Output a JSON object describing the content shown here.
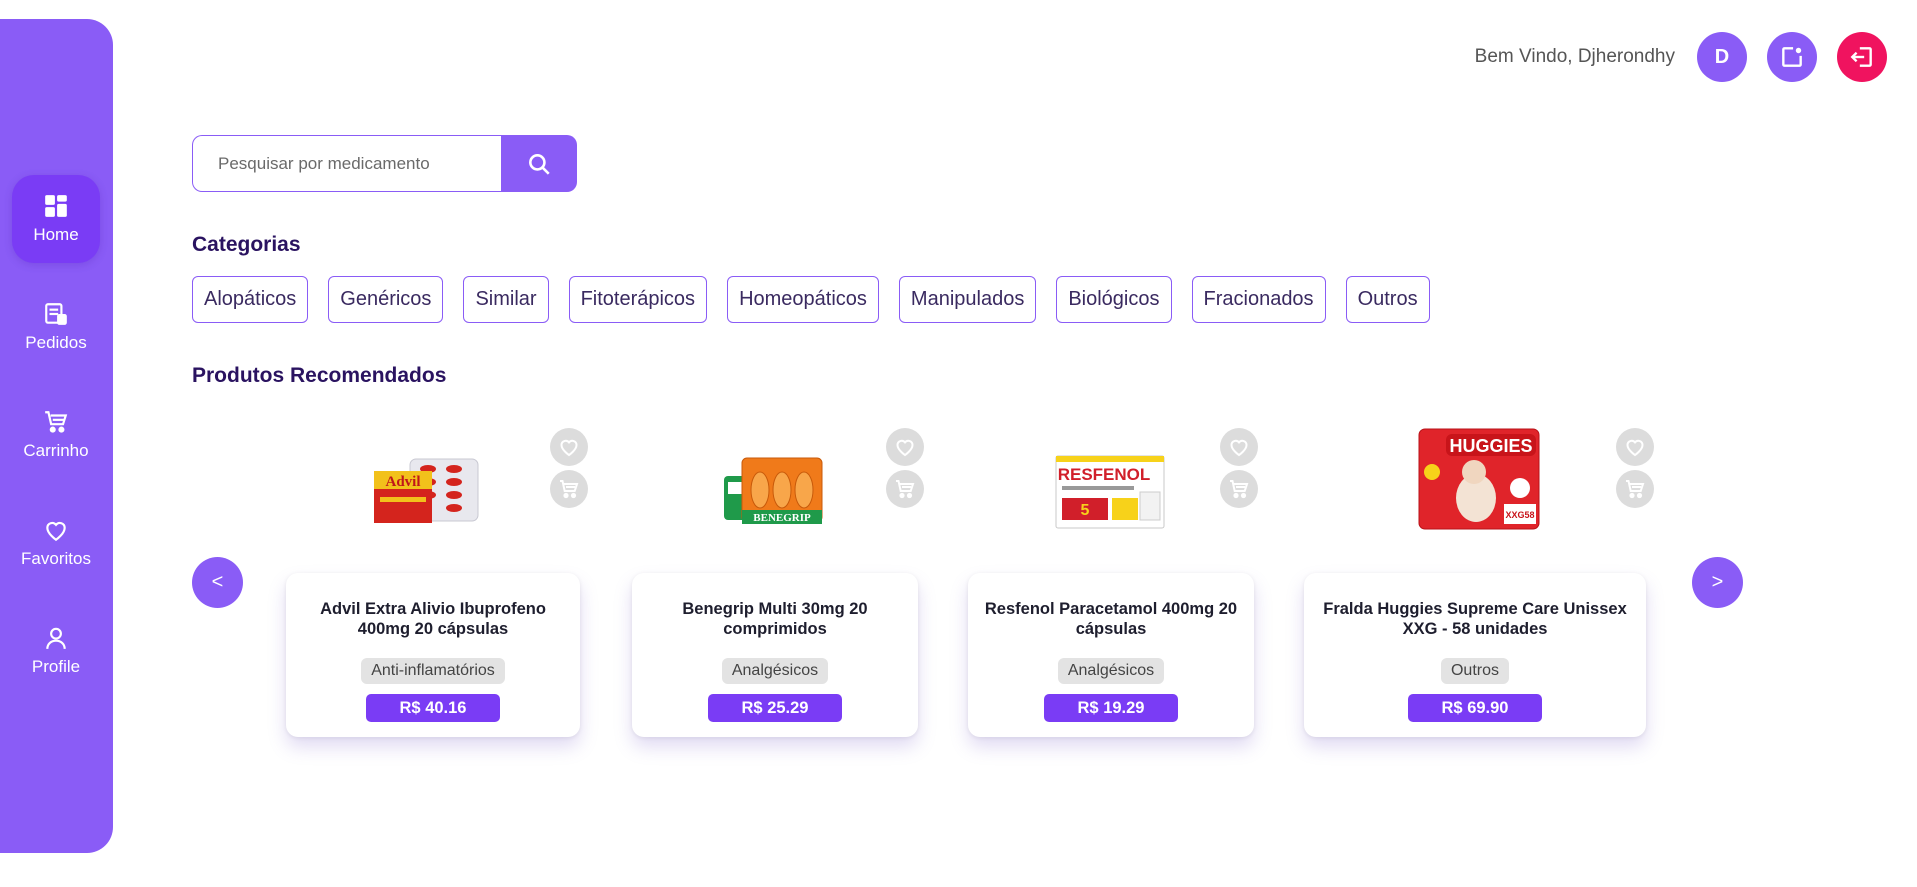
{
  "colors": {
    "primary": "#8a5cf6",
    "active": "#7a3cf5",
    "logout": "#f0135f",
    "title": "#2a1360"
  },
  "sidebar": {
    "items": [
      {
        "label": "Home",
        "icon": "grid-icon",
        "active": true
      },
      {
        "label": "Pedidos",
        "icon": "receipt-icon",
        "active": false
      },
      {
        "label": "Carrinho",
        "icon": "cart-icon",
        "active": false
      },
      {
        "label": "Favoritos",
        "icon": "heart-icon",
        "active": false
      },
      {
        "label": "Profile",
        "icon": "user-icon",
        "active": false
      }
    ]
  },
  "header": {
    "welcome": "Bem Vindo, Djherondhy",
    "avatar_initial": "D",
    "actions": [
      "edit-icon",
      "logout-icon"
    ]
  },
  "search": {
    "placeholder": "Pesquisar por medicamento",
    "value": ""
  },
  "categories": {
    "title": "Categorias",
    "items": [
      "Alopáticos",
      "Genéricos",
      "Similar",
      "Fitoterápicos",
      "Homeopáticos",
      "Manipulados",
      "Biológicos",
      "Fracionados",
      "Outros"
    ]
  },
  "products": {
    "title": "Produtos Recomendados",
    "prev_label": "<",
    "next_label": ">",
    "items": [
      {
        "name": "Advil Extra Alivio Ibuprofeno 400mg 20 cápsulas",
        "category": "Anti-inflamatórios",
        "price": "R$ 40.16",
        "brand": "Advil"
      },
      {
        "name": "Benegrip Multi 30mg 20 comprimidos",
        "category": "Analgésicos",
        "price": "R$ 25.29",
        "brand": "BENEGRIP"
      },
      {
        "name": "Resfenol Paracetamol 400mg 20 cápsulas",
        "category": "Analgésicos",
        "price": "R$ 19.29",
        "brand": "RESFENOL"
      },
      {
        "name": "Fralda Huggies Supreme Care Unissex XXG - 58 unidades",
        "category": "Outros",
        "price": "R$ 69.90",
        "brand": "HUGGIES"
      }
    ]
  }
}
